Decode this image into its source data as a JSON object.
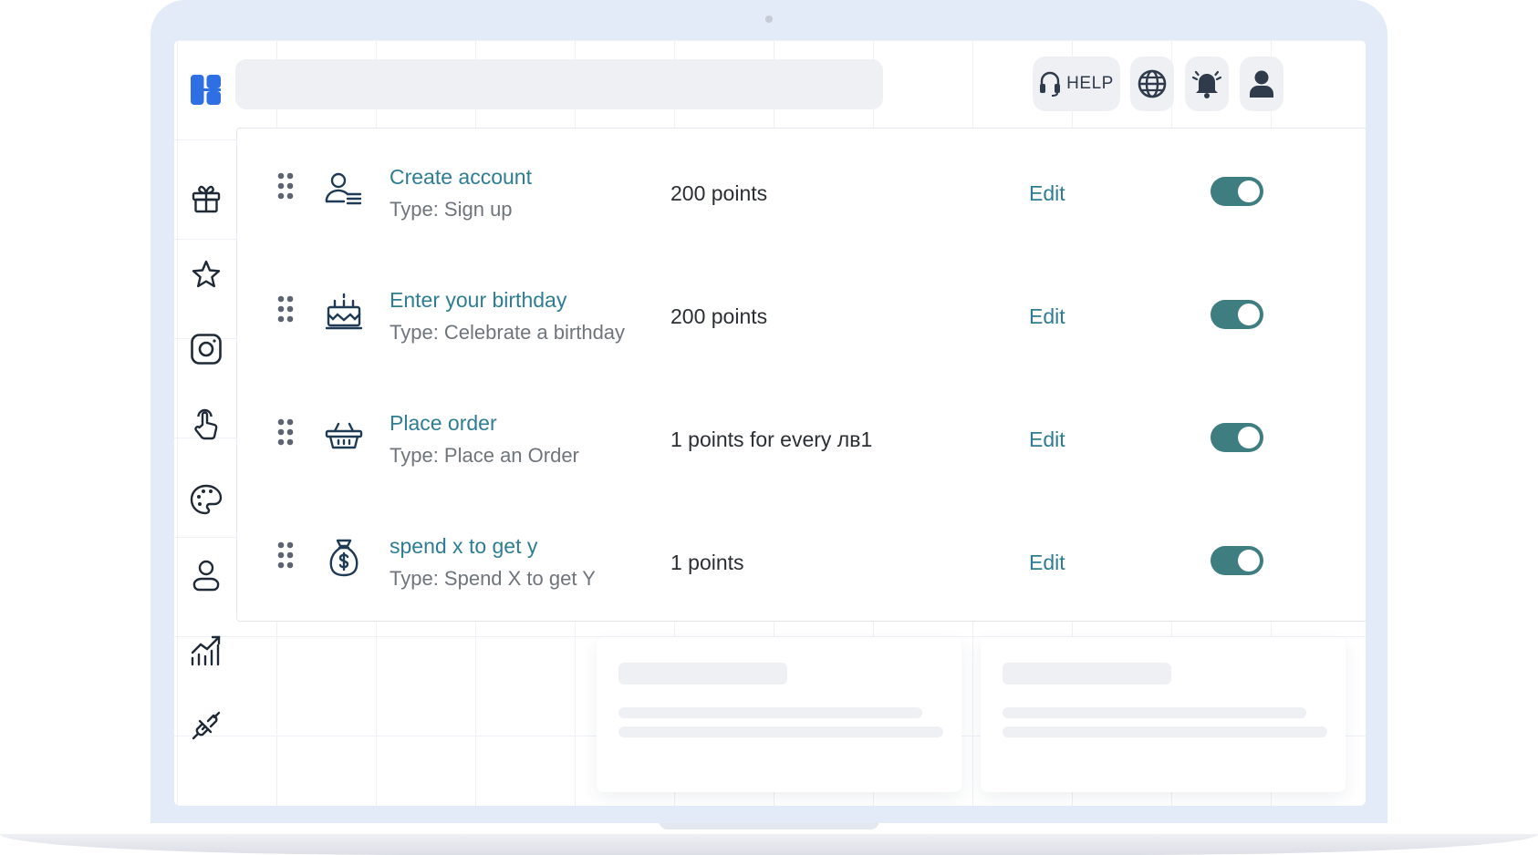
{
  "topbar": {
    "search": {
      "placeholder": "",
      "value": ""
    },
    "help_label": "HELP",
    "icons": [
      "headset-icon",
      "globe-icon",
      "bell-icon",
      "user-icon"
    ]
  },
  "sidebar": {
    "items": [
      {
        "icon": "gift-icon"
      },
      {
        "icon": "star-icon"
      },
      {
        "icon": "instagram-icon"
      },
      {
        "icon": "pointer-hand-icon"
      },
      {
        "icon": "palette-icon"
      },
      {
        "icon": "user-outline-icon"
      },
      {
        "icon": "chart-growth-icon"
      },
      {
        "icon": "plug-icon"
      }
    ]
  },
  "rules": [
    {
      "icon": "user-signup-icon",
      "title": "Create account",
      "type": "Type: Sign up",
      "points": "200 points",
      "edit": "Edit",
      "enabled": true
    },
    {
      "icon": "birthday-cake-icon",
      "title": "Enter your birthday",
      "type": "Type: Celebrate a birthday",
      "points": "200 points",
      "edit": "Edit",
      "enabled": true
    },
    {
      "icon": "basket-icon",
      "title": "Place order",
      "type": "Type: Place an Order",
      "points": "1 points for every лв1",
      "edit": "Edit",
      "enabled": true
    },
    {
      "icon": "money-bag-icon",
      "title": "spend x to get y",
      "type": "Type: Spend X to get Y",
      "points": "1 points",
      "edit": "Edit",
      "enabled": true
    }
  ],
  "colors": {
    "accent": "#2e7d92",
    "toggle_on": "#3e7d80",
    "logo": "#2f6fe4",
    "frame": "#e3eaf8"
  }
}
